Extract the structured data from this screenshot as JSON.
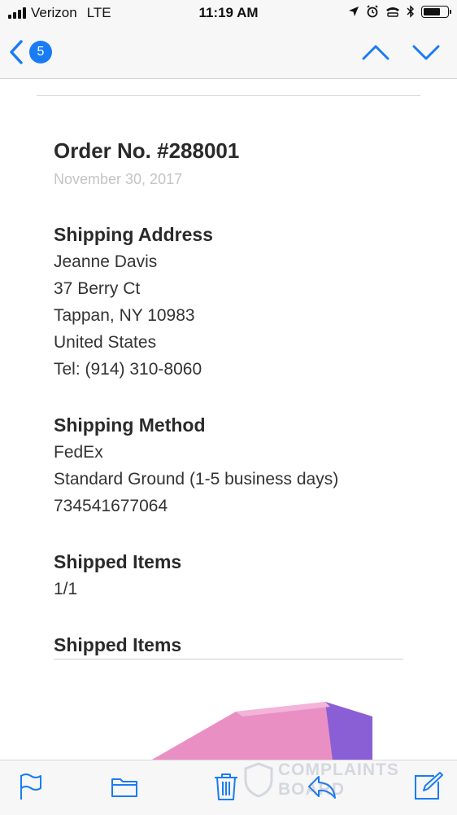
{
  "status_bar": {
    "carrier": "Verizon",
    "network": "LTE",
    "time": "11:19 AM",
    "battery_level": 0.75
  },
  "nav": {
    "back_count": "5"
  },
  "email": {
    "order_title": "Order No. #288001",
    "order_date": "November 30, 2017",
    "shipping_address": {
      "heading": "Shipping Address",
      "lines": [
        "Jeanne Davis",
        "37 Berry Ct",
        "Tappan, NY 10983",
        "United States",
        "Tel: (914) 310-8060"
      ]
    },
    "shipping_method": {
      "heading": "Shipping Method",
      "lines": [
        "FedEx",
        "Standard Ground (1-5 business days)",
        "734541677064"
      ]
    },
    "shipped_items_count": {
      "heading": "Shipped Items",
      "value": "1/1"
    },
    "shipped_items_list": {
      "heading": "Shipped Items"
    }
  },
  "watermark": {
    "line1": "COMPLAINTS",
    "line2": "BOARD"
  },
  "colors": {
    "accent": "#1a7cf5",
    "product_pink": "#ea8fc4",
    "product_purple": "#8a5fd6"
  },
  "icons": {
    "back": "chevron-left-icon",
    "prev": "chevron-up-icon",
    "next": "chevron-down-icon",
    "flag": "flag-icon",
    "folder": "folder-icon",
    "trash": "trash-icon",
    "reply": "reply-icon",
    "compose": "compose-icon"
  }
}
